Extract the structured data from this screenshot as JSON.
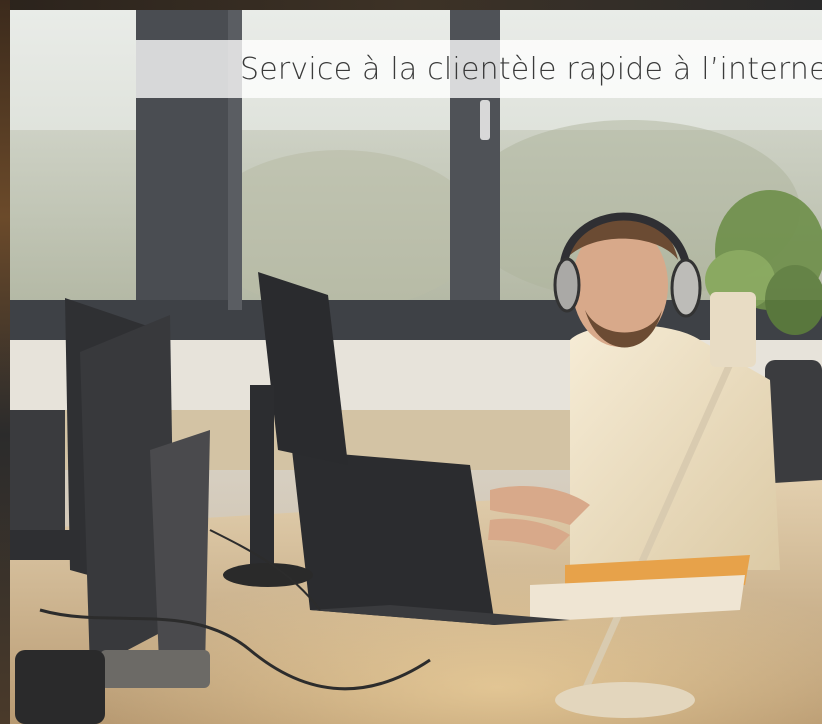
{
  "caption": {
    "text": "Service à la clientèle rapide à l’interne"
  },
  "photo": {
    "subject": "man-with-headphones-at-computer-desk"
  },
  "colors": {
    "caption_band": "#ffffff",
    "caption_text": "#3a3a3a",
    "frame": "#2a2622"
  }
}
